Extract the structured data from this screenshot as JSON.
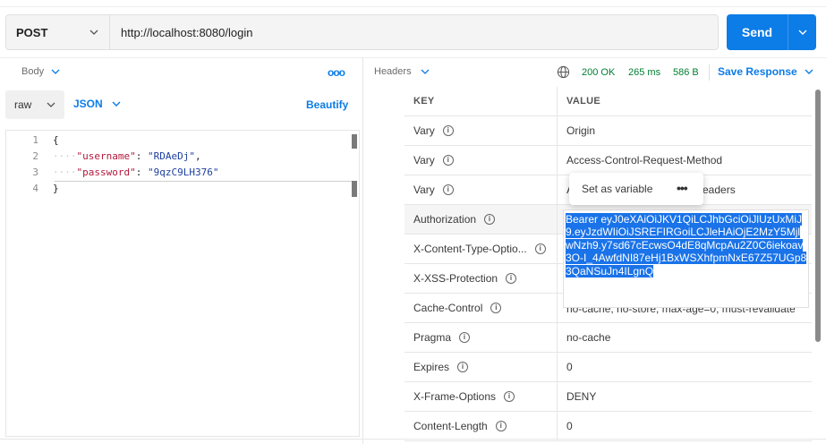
{
  "request": {
    "method": "POST",
    "url": "http://localhost:8080/login",
    "send_label": "Send"
  },
  "body": {
    "tab_label": "Body",
    "more_label": "ooo",
    "mode": "raw",
    "language": "JSON",
    "beautify_label": "Beautify",
    "line_numbers": [
      "1",
      "2",
      "3",
      "4"
    ],
    "lines": {
      "l1": "{",
      "username_key": "\"username\"",
      "username_value": "\"RDAeDj\"",
      "password_key": "\"password\"",
      "password_value": "\"9qzC9LH376\"",
      "l4": "}"
    }
  },
  "response": {
    "tab_label": "Headers",
    "status": "200 OK",
    "time": "265 ms",
    "size": "586 B",
    "save_label": "Save Response",
    "columns": [
      "KEY",
      "VALUE"
    ],
    "rows": [
      {
        "key": "Vary",
        "value": "Origin"
      },
      {
        "key": "Vary",
        "value": "Access-Control-Request-Method"
      },
      {
        "key": "Vary",
        "value_head": "A",
        "value_tail": "eaders"
      },
      {
        "key": "Authorization",
        "value": "Bearer eyJ0eXAiOiJKV1QiLCJhbGciOiJlUzUxMiJ9.eyJzdWIiOiJSREFIRGoiLCJleHAiOjE2MzY5MjlwNzh9.y7sd67cEcwsO4dE8qMcpAu2Z0C6iekoav3O-I_4AwfdNI87eHj1BxWSXhfpmNxE67Z57UGp83QaNSuJn4ILgnQ"
      },
      {
        "key": "X-Content-Type-Optio...",
        "value": ""
      },
      {
        "key": "X-XSS-Protection",
        "value": ""
      },
      {
        "key": "Cache-Control",
        "value": "no-cache, no-store, max-age=0, must-revalidate"
      },
      {
        "key": "Pragma",
        "value": "no-cache"
      },
      {
        "key": "Expires",
        "value": "0"
      },
      {
        "key": "X-Frame-Options",
        "value": "DENY"
      },
      {
        "key": "Content-Length",
        "value": "0"
      }
    ],
    "popup": {
      "set_label": "Set as variable",
      "more_label": "•••"
    }
  },
  "icons": {
    "info": "i"
  }
}
